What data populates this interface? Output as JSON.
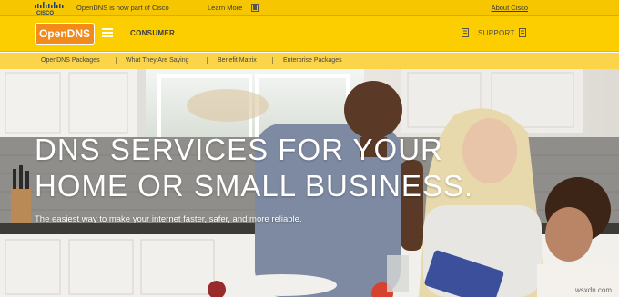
{
  "topbar": {
    "cisco_logo": "cisco-logo",
    "announcement": "OpenDNS is now part of Cisco",
    "learn_more": "Learn More",
    "about_cisco": "About Cisco"
  },
  "navbar": {
    "logo": "OpenDNS",
    "menu_icon": "hamburger-icon",
    "section": "CONSUMER",
    "support": "SUPPORT"
  },
  "subnav": {
    "items": [
      {
        "label": "OpenDNS Packages"
      },
      {
        "label": "What They Are Saying"
      },
      {
        "label": "Benefit Matrix"
      },
      {
        "label": "Enterprise Packages"
      }
    ]
  },
  "hero": {
    "title_line1": "DNS SERVICES FOR YOUR",
    "title_line2": "HOME OR SMALL BUSINESS.",
    "subtitle": "The easiest way to make your internet faster, safer, and more reliable.",
    "image": "family-in-kitchen-photo"
  },
  "watermark": "wsxdn.com",
  "colors": {
    "topbar": "#f6c600",
    "navbar": "#fcce00",
    "subnav": "#fbd44a",
    "logo_orange": "#f28a1c"
  }
}
